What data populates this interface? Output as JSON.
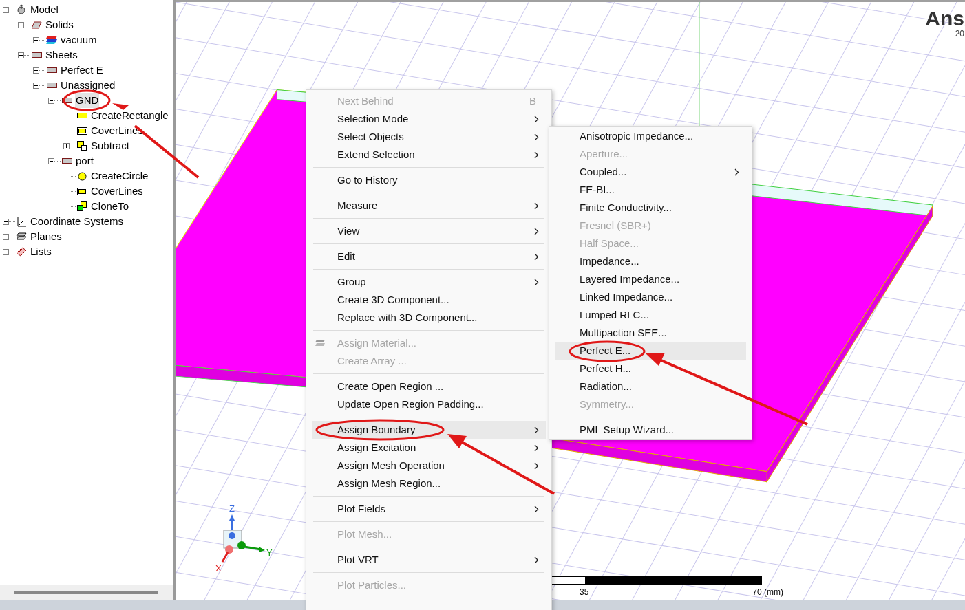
{
  "tree": [
    {
      "label": "Model",
      "kind": "model",
      "expanded": true,
      "selected": false,
      "children": [
        {
          "label": "Solids",
          "kind": "solid",
          "expanded": true,
          "selected": false,
          "children": [
            {
              "label": "vacuum",
              "kind": "material",
              "expanded": false,
              "selected": false
            }
          ]
        },
        {
          "label": "Sheets",
          "kind": "sheet",
          "expanded": true,
          "selected": false,
          "children": [
            {
              "label": "Perfect E",
              "kind": "sheet",
              "expanded": false,
              "selected": false
            },
            {
              "label": "Unassigned",
              "kind": "sheet",
              "expanded": true,
              "selected": false,
              "children": [
                {
                  "label": "GND",
                  "kind": "sheet",
                  "expanded": true,
                  "selected": true,
                  "children": [
                    {
                      "label": "CreateRectangle",
                      "kind": "rect",
                      "selected": false
                    },
                    {
                      "label": "CoverLines",
                      "kind": "cover",
                      "selected": false
                    },
                    {
                      "label": "Subtract",
                      "kind": "subtract",
                      "expanded": false,
                      "selected": false
                    }
                  ]
                },
                {
                  "label": "port",
                  "kind": "sheet",
                  "expanded": true,
                  "selected": false,
                  "children": [
                    {
                      "label": "CreateCircle",
                      "kind": "circle",
                      "selected": false
                    },
                    {
                      "label": "CoverLines",
                      "kind": "cover",
                      "selected": false
                    },
                    {
                      "label": "CloneTo",
                      "kind": "clone",
                      "selected": false
                    }
                  ]
                }
              ]
            }
          ]
        }
      ]
    },
    {
      "label": "Coordinate Systems",
      "kind": "coords",
      "expanded": false,
      "selected": false
    },
    {
      "label": "Planes",
      "kind": "planes",
      "expanded": false,
      "selected": false
    },
    {
      "label": "Lists",
      "kind": "lists",
      "expanded": false,
      "selected": false
    }
  ],
  "viewport": {
    "brand": "Ans",
    "brand_sub": "20",
    "axes": {
      "z": "Z",
      "y": "Y",
      "x": "X"
    },
    "scale": {
      "mid": "35",
      "end": "70 (mm)"
    }
  },
  "context_menu": [
    {
      "kind": "item",
      "label": "Next Behind",
      "shortcut": "B",
      "disabled": true,
      "submenu": false,
      "selected": false
    },
    {
      "kind": "item",
      "label": "Selection Mode",
      "disabled": false,
      "submenu": true,
      "selected": false
    },
    {
      "kind": "item",
      "label": "Select Objects",
      "disabled": false,
      "submenu": true,
      "selected": false
    },
    {
      "kind": "item",
      "label": "Extend Selection",
      "disabled": false,
      "submenu": true,
      "selected": false
    },
    {
      "kind": "separator"
    },
    {
      "kind": "item",
      "label": "Go to History",
      "disabled": false,
      "submenu": false,
      "selected": false
    },
    {
      "kind": "separator"
    },
    {
      "kind": "item",
      "label": "Measure",
      "disabled": false,
      "submenu": true,
      "selected": false
    },
    {
      "kind": "separator"
    },
    {
      "kind": "item",
      "label": "View",
      "disabled": false,
      "submenu": true,
      "selected": false
    },
    {
      "kind": "separator"
    },
    {
      "kind": "item",
      "label": "Edit",
      "disabled": false,
      "submenu": true,
      "selected": false
    },
    {
      "kind": "separator"
    },
    {
      "kind": "item",
      "label": "Group",
      "disabled": false,
      "submenu": true,
      "selected": false
    },
    {
      "kind": "item",
      "label": "Create 3D Component...",
      "disabled": false,
      "submenu": false,
      "selected": false
    },
    {
      "kind": "item",
      "label": "Replace with 3D Component...",
      "disabled": false,
      "submenu": false,
      "selected": false
    },
    {
      "kind": "separator"
    },
    {
      "kind": "icon_item",
      "label": "Assign Material...",
      "disabled": true,
      "submenu": false,
      "selected": false
    },
    {
      "kind": "item",
      "label": "Create Array ...",
      "disabled": true,
      "submenu": false,
      "selected": false
    },
    {
      "kind": "separator"
    },
    {
      "kind": "item",
      "label": "Create Open Region ...",
      "disabled": false,
      "submenu": false,
      "selected": false
    },
    {
      "kind": "item",
      "label": "Update Open Region Padding...",
      "disabled": false,
      "submenu": false,
      "selected": false
    },
    {
      "kind": "separator"
    },
    {
      "kind": "item",
      "label": "Assign Boundary",
      "disabled": false,
      "submenu": true,
      "selected": true
    },
    {
      "kind": "item",
      "label": "Assign Excitation",
      "disabled": false,
      "submenu": true,
      "selected": false
    },
    {
      "kind": "item",
      "label": "Assign Mesh Operation",
      "disabled": false,
      "submenu": true,
      "selected": false
    },
    {
      "kind": "item",
      "label": "Assign Mesh Region...",
      "disabled": false,
      "submenu": false,
      "selected": false
    },
    {
      "kind": "separator"
    },
    {
      "kind": "item",
      "label": "Plot Fields",
      "disabled": false,
      "submenu": true,
      "selected": false
    },
    {
      "kind": "separator"
    },
    {
      "kind": "item",
      "label": "Plot Mesh...",
      "disabled": true,
      "submenu": false,
      "selected": false
    },
    {
      "kind": "separator"
    },
    {
      "kind": "item",
      "label": "Plot VRT",
      "disabled": false,
      "submenu": true,
      "selected": false
    },
    {
      "kind": "separator"
    },
    {
      "kind": "item",
      "label": "Plot Particles...",
      "disabled": true,
      "submenu": false,
      "selected": false
    },
    {
      "kind": "separator"
    }
  ],
  "submenu": [
    {
      "kind": "item",
      "label": "Anisotropic Impedance...",
      "disabled": false,
      "submenu": false,
      "selected": false
    },
    {
      "kind": "item",
      "label": "Aperture...",
      "disabled": true,
      "submenu": false,
      "selected": false
    },
    {
      "kind": "item",
      "label": "Coupled...",
      "disabled": false,
      "submenu": true,
      "selected": false
    },
    {
      "kind": "item",
      "label": "FE-BI...",
      "disabled": false,
      "submenu": false,
      "selected": false
    },
    {
      "kind": "item",
      "label": "Finite Conductivity...",
      "disabled": false,
      "submenu": false,
      "selected": false
    },
    {
      "kind": "item",
      "label": "Fresnel (SBR+)",
      "disabled": true,
      "submenu": false,
      "selected": false
    },
    {
      "kind": "item",
      "label": "Half Space...",
      "disabled": true,
      "submenu": false,
      "selected": false
    },
    {
      "kind": "item",
      "label": "Impedance...",
      "disabled": false,
      "submenu": false,
      "selected": false
    },
    {
      "kind": "item",
      "label": "Layered Impedance...",
      "disabled": false,
      "submenu": false,
      "selected": false
    },
    {
      "kind": "item",
      "label": "Linked Impedance...",
      "disabled": false,
      "submenu": false,
      "selected": false
    },
    {
      "kind": "item",
      "label": "Lumped RLC...",
      "disabled": false,
      "submenu": false,
      "selected": false
    },
    {
      "kind": "item",
      "label": "Multipaction SEE...",
      "disabled": false,
      "submenu": false,
      "selected": false
    },
    {
      "kind": "item",
      "label": "Perfect E...",
      "disabled": false,
      "submenu": false,
      "selected": true
    },
    {
      "kind": "item",
      "label": "Perfect H...",
      "disabled": false,
      "submenu": false,
      "selected": false
    },
    {
      "kind": "item",
      "label": "Radiation...",
      "disabled": false,
      "submenu": false,
      "selected": false
    },
    {
      "kind": "item",
      "label": "Symmetry...",
      "disabled": true,
      "submenu": false,
      "selected": false
    },
    {
      "kind": "separator"
    },
    {
      "kind": "item",
      "label": "PML Setup Wizard...",
      "disabled": false,
      "submenu": false,
      "selected": false
    }
  ]
}
